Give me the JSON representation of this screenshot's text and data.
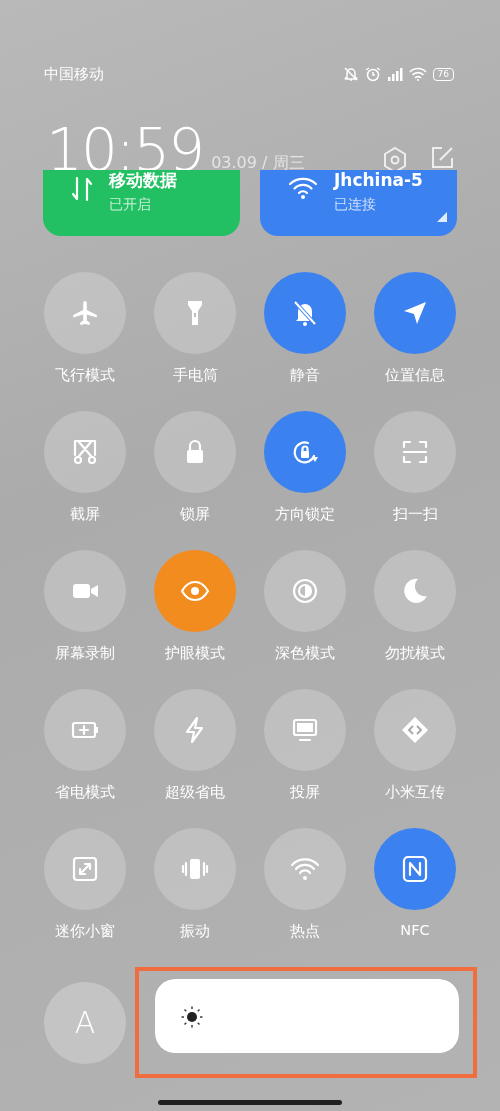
{
  "status_bar": {
    "carrier": "中国移动",
    "battery": "76"
  },
  "header": {
    "time": "10:59",
    "date": "03.09 / 周三"
  },
  "cards": [
    {
      "title": "移动数据",
      "subtitle": "已开启",
      "color": "#22c063"
    },
    {
      "title": "Jhchina-5",
      "subtitle": "已连接",
      "color": "#3b82f0"
    }
  ],
  "tiles": [
    {
      "label": "飞行模式",
      "on": false
    },
    {
      "label": "手电筒",
      "on": false
    },
    {
      "label": "静音",
      "on": true,
      "color": "#3b82f0"
    },
    {
      "label": "位置信息",
      "on": true,
      "color": "#3b82f0"
    },
    {
      "label": "截屏",
      "on": false
    },
    {
      "label": "锁屏",
      "on": false
    },
    {
      "label": "方向锁定",
      "on": true,
      "color": "#3b82f0"
    },
    {
      "label": "扫一扫",
      "on": false
    },
    {
      "label": "屏幕录制",
      "on": false
    },
    {
      "label": "护眼模式",
      "on": true,
      "color": "#f28c1e"
    },
    {
      "label": "深色模式",
      "on": false
    },
    {
      "label": "勿扰模式",
      "on": false
    },
    {
      "label": "省电模式",
      "on": false
    },
    {
      "label": "超级省电",
      "on": false
    },
    {
      "label": "投屏",
      "on": false
    },
    {
      "label": "小米互传",
      "on": false
    },
    {
      "label": "迷你小窗",
      "on": false
    },
    {
      "label": "振动",
      "on": false
    },
    {
      "label": "热点",
      "on": false
    },
    {
      "label": "NFC",
      "on": true,
      "color": "#3b82f0"
    }
  ],
  "auto_brightness": {
    "label": "A"
  },
  "brightness": {
    "level": 1.0
  }
}
